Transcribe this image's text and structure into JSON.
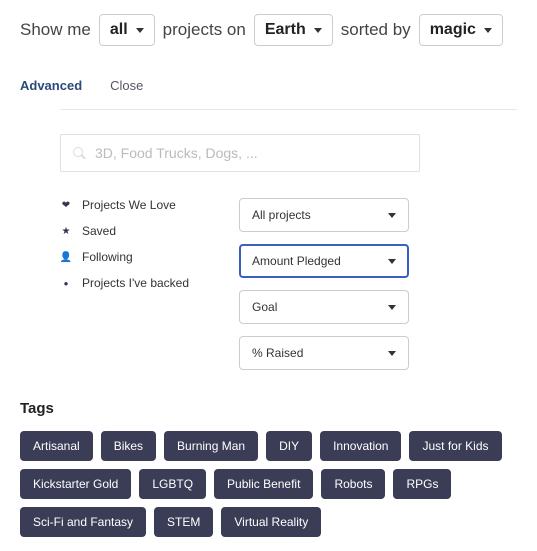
{
  "filter": {
    "t1": "Show me",
    "dd1": "all",
    "t2": "projects on",
    "dd2": "Earth",
    "t3": "sorted by",
    "dd3": "magic"
  },
  "adv": {
    "advanced": "Advanced",
    "close": "Close"
  },
  "search": {
    "placeholder": "3D, Food Trucks, Dogs, ..."
  },
  "love": {
    "items": [
      {
        "label": "Projects We Love"
      },
      {
        "label": "Saved"
      },
      {
        "label": "Following"
      },
      {
        "label": "Projects I've backed"
      }
    ]
  },
  "selects": {
    "items": [
      {
        "label": "All projects",
        "active": false
      },
      {
        "label": "Amount Pledged",
        "active": true
      },
      {
        "label": "Goal",
        "active": false
      },
      {
        "label": "% Raised",
        "active": false
      }
    ]
  },
  "tags": {
    "title": "Tags",
    "items": [
      "Artisanal",
      "Bikes",
      "Burning Man",
      "DIY",
      "Innovation",
      "Just for Kids",
      "Kickstarter Gold",
      "LGBTQ",
      "Public Benefit",
      "Robots",
      "RPGs",
      "Sci-Fi and Fantasy",
      "STEM",
      "Virtual Reality"
    ]
  }
}
